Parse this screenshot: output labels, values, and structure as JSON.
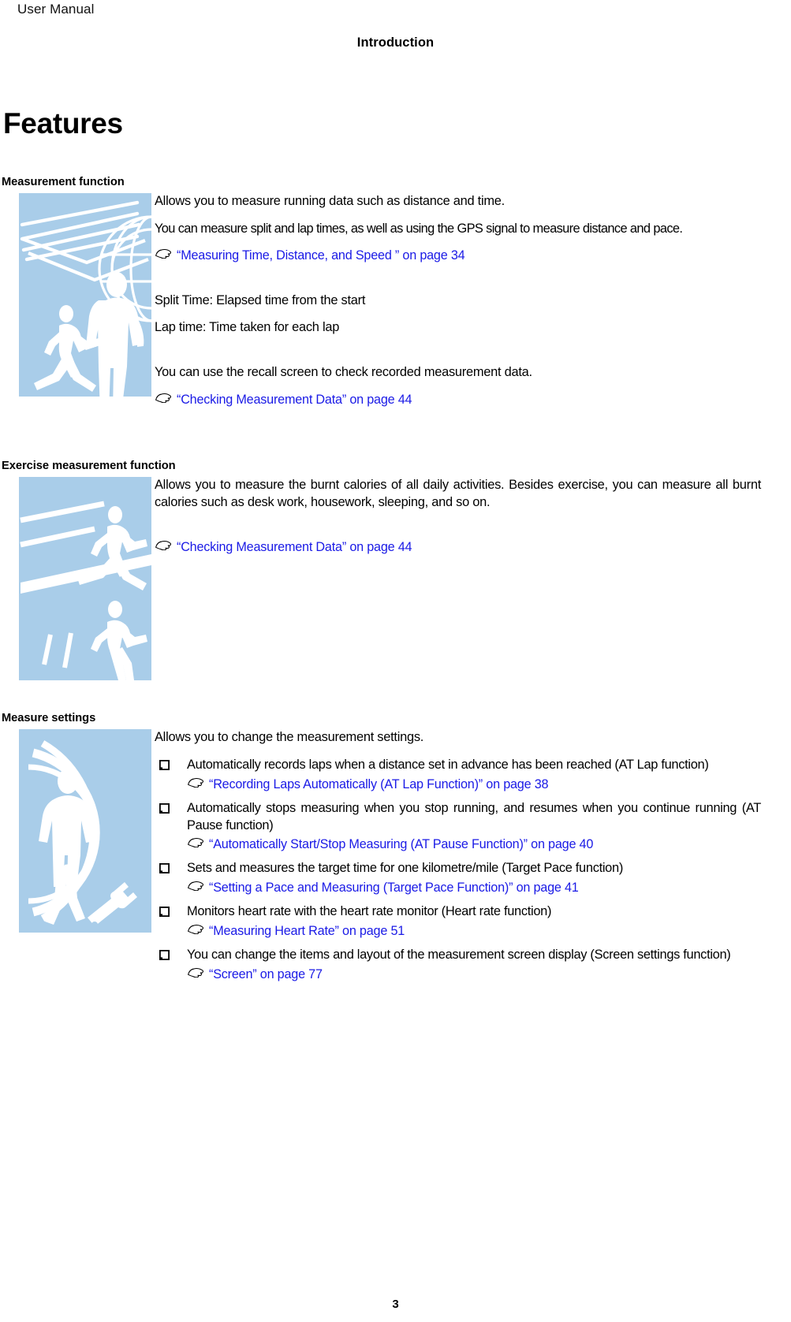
{
  "header": {
    "manual_name": "User Manual",
    "chapter_title": "Introduction"
  },
  "page_title": "Features",
  "page_number": "3",
  "colors": {
    "link": "#1a1ae6",
    "illustration_fill": "#a9cde9",
    "illustration_detail": "#ffffff",
    "text": "#000000"
  },
  "icons": {
    "xref": "pointing-hand-icon",
    "bullet": "hollow-square-bullet-icon"
  },
  "sections": [
    {
      "id": "measurement",
      "heading": "Measurement function",
      "illustration_name": "runners-track-globe-illustration",
      "blocks": [
        {
          "kind": "para",
          "text": "Allows you to measure running data such as distance and time."
        },
        {
          "kind": "para",
          "text": "You can measure split and lap times, as well as using the GPS signal to measure distance and pace."
        },
        {
          "kind": "xref",
          "text": "“Measuring Time, Distance, and Speed ” on page 34"
        },
        {
          "kind": "spacer"
        },
        {
          "kind": "para",
          "text": "Split Time: Elapsed time from the start"
        },
        {
          "kind": "para",
          "text": "Lap time: Time taken for each lap"
        },
        {
          "kind": "spacer"
        },
        {
          "kind": "para",
          "text": "You can use the recall screen to check recorded measurement data."
        },
        {
          "kind": "xref",
          "text": "“Checking Measurement Data” on page 44"
        }
      ]
    },
    {
      "id": "exercise",
      "heading": "Exercise measurement function",
      "illustration_name": "runners-lane-lines-illustration",
      "blocks": [
        {
          "kind": "para",
          "text": "Allows you to measure the burnt calories of all daily activities. Besides exercise, you can measure all burnt calories such as desk work, housework, sleeping, and so on."
        },
        {
          "kind": "spacer"
        },
        {
          "kind": "xref",
          "text": "“Checking Measurement Data” on page 44"
        }
      ]
    },
    {
      "id": "settings",
      "heading": "Measure settings",
      "illustration_name": "runner-arcs-wrench-illustration",
      "intro": "Allows you to change the measurement settings.",
      "bullets": [
        {
          "text": "Automatically records laps when a distance set in advance has been reached (AT Lap function)",
          "xref": "“Recording Laps Automatically (AT Lap Function)” on page 38"
        },
        {
          "text": "Automatically stops measuring when you stop running, and resumes when you continue running (AT Pause function)",
          "xref": "“Automatically Start/Stop Measuring (AT Pause Function)” on page 40"
        },
        {
          "text": "Sets and measures the target time for one kilometre/mile (Target Pace function)",
          "xref": "“Setting a Pace and Measuring (Target Pace Function)” on page 41"
        },
        {
          "text": "Monitors heart rate with the heart rate monitor (Heart rate function)",
          "xref": "“Measuring Heart Rate” on page 51"
        },
        {
          "text": "You can change the items and layout of the measurement screen display (Screen settings function)",
          "xref": "“Screen” on page 77"
        }
      ]
    }
  ]
}
